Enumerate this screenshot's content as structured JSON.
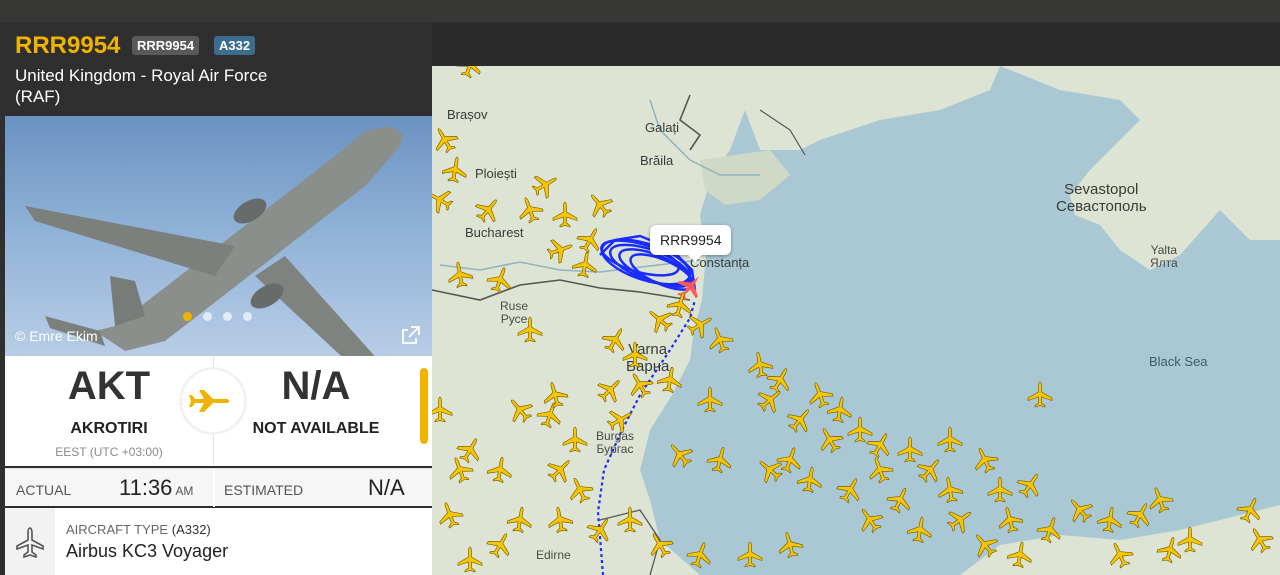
{
  "flight": {
    "callsign": "RRR9954",
    "callsign_badge": "RRR9954",
    "type_badge": "A332",
    "airline": "United Kingdom - Royal Air Force (RAF)"
  },
  "photo": {
    "credit": "© Emre Ekim",
    "dots": 4,
    "active_dot": 1
  },
  "route": {
    "origin_code": "AKT",
    "origin_name": "AKROTIRI",
    "origin_tz": "EEST (UTC +03:00)",
    "dest_code": "N/A",
    "dest_name": "NOT AVAILABLE"
  },
  "times": {
    "actual_label": "ACTUAL",
    "actual_time": "11:36",
    "actual_unit": "AM",
    "estimated_label": "ESTIMATED",
    "estimated_value": "N/A"
  },
  "aircraft": {
    "type_label": "AIRCRAFT TYPE",
    "type_code": "(A332)",
    "type_name": "Airbus KC3 Voyager"
  },
  "map": {
    "callout": "RRR9954",
    "labels": {
      "brasov": "Brașov",
      "galati": "Galați",
      "braila": "Brăila",
      "ploiesti": "Ploiești",
      "bucharest": "Bucharest",
      "constanta": "Constanța",
      "ruse": "Ruse",
      "ruse_cyr": "Русе",
      "varna": "Varna",
      "varna_cyr": "Варна",
      "burgas": "Burgas",
      "burgas_cyr": "Бургас",
      "edirne": "Edirne",
      "sevastopol": "Sevastopol",
      "sevastopol_cyr": "Севастополь",
      "yalta": "Yalta",
      "yalta_cyr": "Ялта",
      "black_sea": "Black Sea"
    },
    "colors": {
      "land": "#dfe5d6",
      "sea": "#a9c8d3",
      "plane": "#f7c600",
      "track": "#1a2cff",
      "selected": "#ff4a4a",
      "accent": "#f0b400"
    }
  }
}
